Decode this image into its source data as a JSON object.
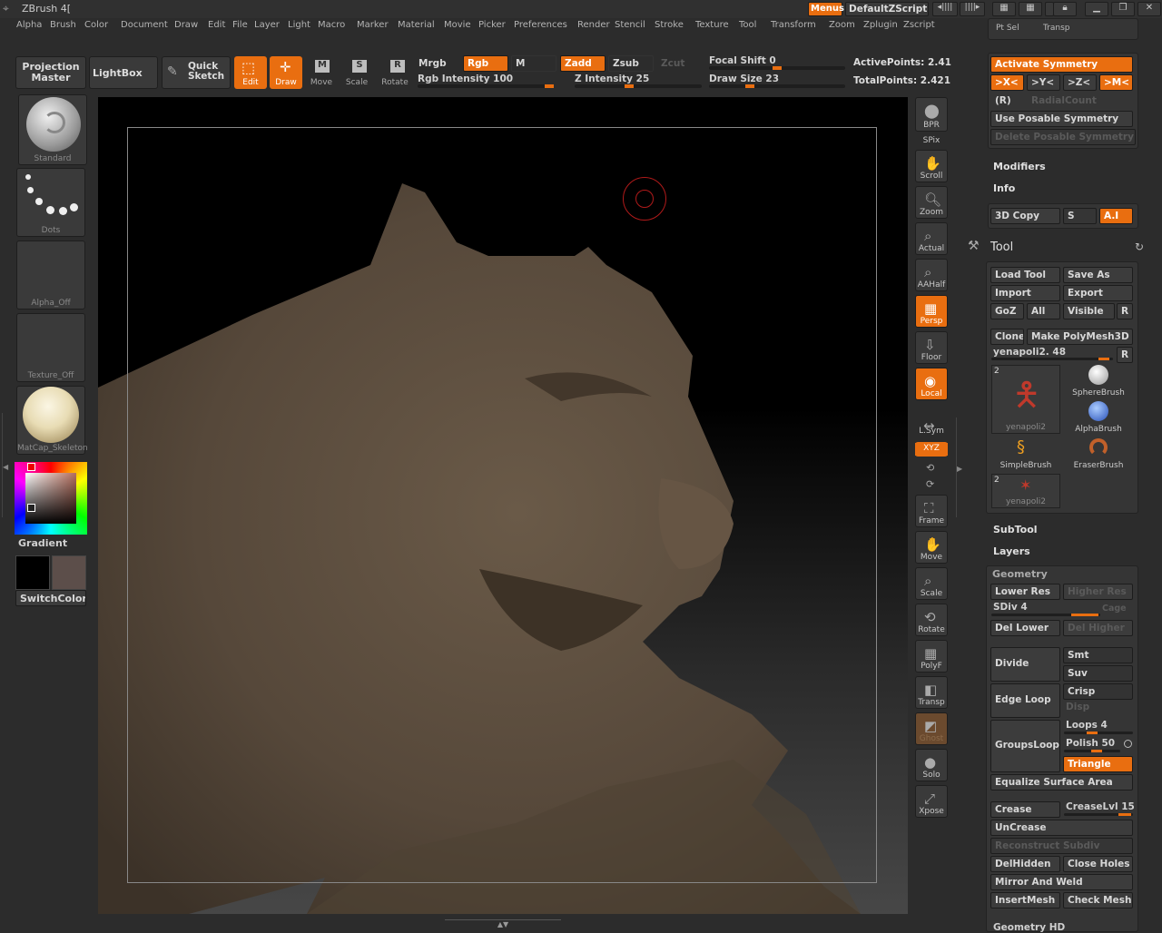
{
  "app": {
    "title": "ZBrush 4[",
    "menus_label": "Menus",
    "script_name": "DefaultZScript"
  },
  "menubar": [
    "Alpha",
    "Brush",
    "Color",
    "Document",
    "Draw",
    "Edit",
    "File",
    "Layer",
    "Light",
    "Macro",
    "Marker",
    "Material",
    "Movie",
    "Picker",
    "Preferences",
    "Render",
    "Stencil",
    "Stroke",
    "Texture",
    "Tool",
    "Transform",
    "Zoom",
    "Zplugin",
    "Zscript"
  ],
  "toolbar": {
    "projection_master": "Projection\nMaster",
    "lightbox": "LightBox",
    "quick_sketch": "Quick\nSketch",
    "edit": "Edit",
    "draw": "Draw",
    "move": "Move",
    "scale": "Scale",
    "rotate": "Rotate",
    "mrgb": "Mrgb",
    "rgb": "Rgb",
    "m": "M",
    "zadd": "Zadd",
    "zsub": "Zsub",
    "zcut": "Zcut",
    "rgb_intensity": "Rgb Intensity 100",
    "z_intensity": "Z Intensity 25",
    "focal_shift": "Focal Shift 0",
    "draw_size": "Draw Size 23",
    "active_points": "ActivePoints: 2.41",
    "total_points": "TotalPoints: 2.421",
    "rgb_intensity_value": 100,
    "z_intensity_value": 25,
    "focal_shift_value": 0,
    "draw_size_value": 23
  },
  "left_shelf": {
    "brush": "Standard",
    "stroke": "Dots",
    "alpha": "Alpha_Off",
    "texture": "Texture_Off",
    "material": "MatCap_Skeleton",
    "gradient": "Gradient",
    "switch_color": "SwitchColor"
  },
  "right_shelf": [
    "BPR",
    "SPix",
    "Scroll",
    "Zoom",
    "Actual",
    "AAHalf",
    "Persp",
    "Floor",
    "Local",
    "L.Sym",
    "XYZ",
    "Frame",
    "Move",
    "Scale",
    "Rotate",
    "PolyF",
    "Transp",
    "Ghost",
    "Solo",
    "Xpose"
  ],
  "panel": {
    "pt_sel": "Pt Sel",
    "transp": "Transp",
    "activate_symmetry": "Activate Symmetry",
    "sym_x": ">X<",
    "sym_y": ">Y<",
    "sym_z": ">Z<",
    "sym_m": ">M<",
    "r": "(R)",
    "radial_count": "RadialCount",
    "use_posable_symmetry": "Use Posable Symmetry",
    "delete_posable_symmetry": "Delete Posable Symmetry",
    "modifiers": "Modifiers",
    "info": "Info",
    "copy3d": "3D Copy",
    "s": "S",
    "ai": "A.I",
    "tool_title": "Tool",
    "load_tool": "Load Tool",
    "save_as": "Save As",
    "import": "Import",
    "export": "Export",
    "goz": "GoZ",
    "all": "All",
    "visible": "Visible",
    "r_btn": "R",
    "clone": "Clone",
    "make_polymesh": "Make PolyMesh3D",
    "current_tool": "yenapoli2. 48",
    "tools": [
      {
        "name": "yenapoli2",
        "badge": "2"
      },
      {
        "name": "SphereBrush"
      },
      {
        "name": "AlphaBrush"
      },
      {
        "name": "SimpleBrush"
      },
      {
        "name": "EraserBrush"
      },
      {
        "name": "yenapoli2",
        "badge": "2"
      }
    ],
    "subtool": "SubTool",
    "layers": "Layers",
    "geometry": "Geometry",
    "lower_res": "Lower Res",
    "higher_res": "Higher Res",
    "sdiv": "SDiv 4",
    "cage": "Cage",
    "del_lower": "Del Lower",
    "del_higher": "Del Higher",
    "divide": "Divide",
    "smt": "Smt",
    "suv": "Suv",
    "edge_loop": "Edge Loop",
    "crisp": "Crisp",
    "disp": "Disp",
    "groups_loops": "GroupsLoops",
    "loops": "Loops 4",
    "polish": "Polish 50",
    "triangle": "Triangle",
    "equalize": "Equalize Surface Area",
    "crease": "Crease",
    "crease_lvl": "CreaseLvl 15",
    "uncrease": "UnCrease",
    "reconstruct": "Reconstruct Subdiv",
    "delhidden": "DelHidden",
    "close_holes": "Close Holes",
    "mirror_weld": "Mirror And Weld",
    "insert_mesh": "InsertMesh",
    "check_mesh": "Check Mesh",
    "geometry_hd": "Geometry HD"
  },
  "colors": {
    "accent": "#e96e10",
    "bg": "#2c2c2c",
    "canvas": "#000000",
    "model": "#5c4e3e"
  }
}
